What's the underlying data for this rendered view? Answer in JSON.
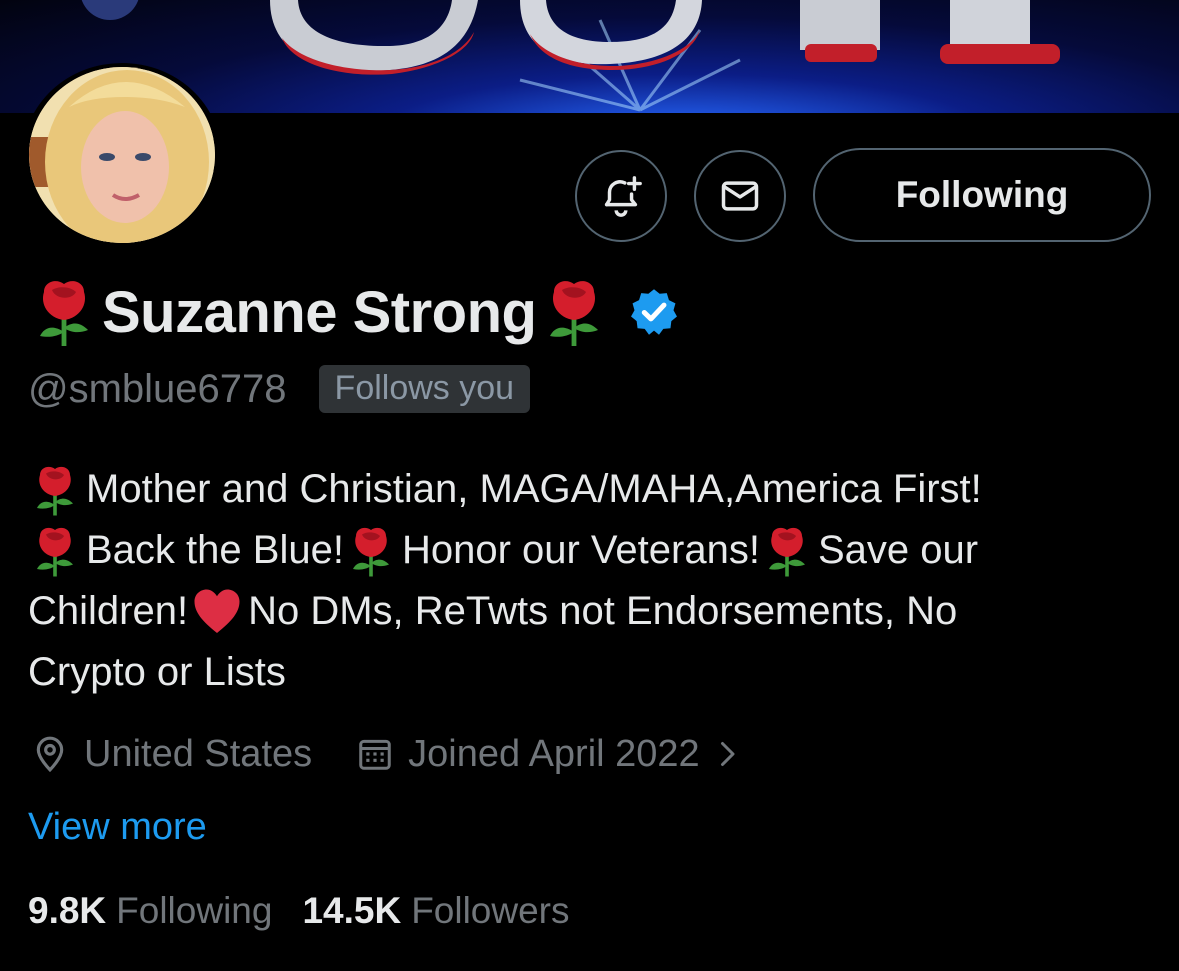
{
  "profile": {
    "display_name": "Suzanne Strong",
    "name_prefix_emoji": "rose-icon",
    "name_suffix_emoji": "rose-icon",
    "verified": true,
    "verified_color": "#1d9bf0",
    "handle": "@smblue6778",
    "follows_you_label": "Follows you"
  },
  "actions": {
    "notify_icon": "bell-plus-icon",
    "message_icon": "envelope-icon",
    "follow_button_label": "Following"
  },
  "bio": {
    "line1": "Mother and Christian, MAGA/MAHA,America First!",
    "line2_a": "Back the Blue!",
    "line2_b": "Honor our Veterans!",
    "line2_c": "Save our",
    "line3_a": "Children!",
    "line3_b": "No DMs, ReTwts not Endorsements, No",
    "line4": "Crypto or Lists"
  },
  "meta": {
    "location": "United States",
    "joined": "Joined April 2022"
  },
  "view_more_label": "View more",
  "stats": {
    "following_count": "9.8K",
    "following_label": "Following",
    "followers_count": "14.5K",
    "followers_label": "Followers"
  },
  "colors": {
    "background": "#000000",
    "text_primary": "#e7e9ea",
    "text_secondary": "#71767b",
    "link": "#1d9bf0",
    "border": "#536471"
  }
}
